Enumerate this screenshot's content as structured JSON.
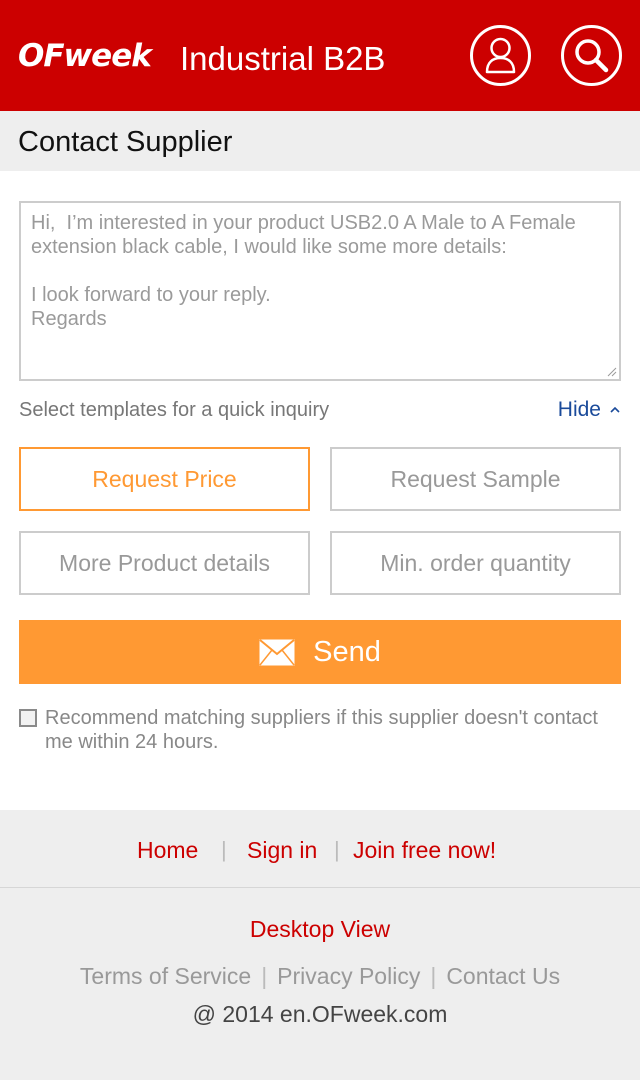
{
  "header": {
    "logo_text": "OFweek",
    "site_title": "Industrial B2B",
    "user_icon": "user-icon",
    "search_icon": "search-icon",
    "bg_color": "#cc0000"
  },
  "page": {
    "title": "Contact Supplier"
  },
  "message": {
    "text": "Hi,  I’m interested in your product USB2.0 A Male to A Female extension black cable, I would like some more details:\n\nI look forward to your reply.\nRegards"
  },
  "templates": {
    "label": "Select templates for a quick inquiry",
    "hide_label": "Hide",
    "buttons": [
      {
        "label": "Request Price",
        "active": true
      },
      {
        "label": "Request Sample",
        "active": false
      },
      {
        "label": "More Product details",
        "active": false
      },
      {
        "label": "Min. order quantity",
        "active": false
      }
    ]
  },
  "send": {
    "label": "Send",
    "icon": "envelope-icon",
    "color": "#ff9933"
  },
  "recommend": {
    "checked": false,
    "text": "Recommend matching suppliers if this supplier doesn't contact me within 24 hours."
  },
  "footer": {
    "nav": {
      "home": "Home",
      "sign_in": "Sign in",
      "join": "Join free now!",
      "separator": "|"
    },
    "desktop_view": "Desktop View",
    "links": {
      "terms": "Terms of Service",
      "privacy": "Privacy Policy",
      "contact": "Contact Us",
      "separator": "|"
    },
    "copyright": "@ 2014 en.OFweek.com"
  }
}
